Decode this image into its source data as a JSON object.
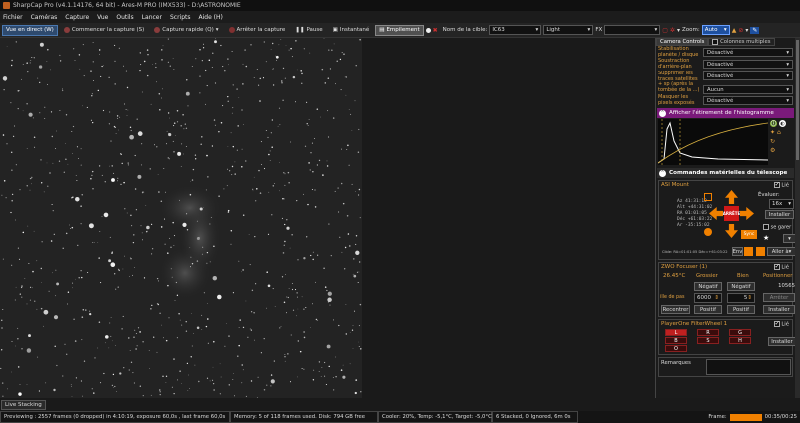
{
  "window": {
    "title": "SharpCap Pro (v4.1.14176, 64 bit) - Ares-M PRO (IMX533) - D:\\ASTRONOMIE"
  },
  "menu": [
    "Fichier",
    "Caméras",
    "Capture",
    "Vue",
    "Outils",
    "Lancer",
    "Scripts",
    "Aide (H)"
  ],
  "toolbar": {
    "live_view": "Vue en direct (W)",
    "start_capture": "Commencer la capture (S)",
    "quick_capture": "Capture rapide (Q)",
    "stop_capture": "Arrêter la capture",
    "pause": "Pause",
    "snapshot": "Instantané",
    "stacking": "Empilement",
    "target_label": "Nom de la cible:",
    "target_value": "IC63",
    "frame_type": "Light",
    "fx_label": "FX",
    "zoom_label": "Zoom:",
    "zoom_value": "Auto"
  },
  "panel": {
    "tabs": [
      "Camera Controls",
      "Colonnes multiples"
    ],
    "controls": [
      {
        "label": "Stabilisation planète / disque",
        "value": "Désactivé"
      },
      {
        "label": "Soustraction d'arrière-plan",
        "value": "Désactivé"
      },
      {
        "label": "Supprimer les traces satellites + sp (après la tombée de la ...)",
        "value": "Désactivé"
      },
      {
        "label": "",
        "value": "Aucun"
      },
      {
        "label": "Masquer les pixels exposés",
        "value": "Désactivé"
      }
    ],
    "histogram_header": "Afficher l'étirement de l'histogramme",
    "telescope_header": "Commandes matérielles du télescope",
    "mount": {
      "title": "ASI Mount",
      "lie": "Lié",
      "evaluer": "Évaluer:",
      "speed": "16x",
      "installer": "Installer",
      "stop": "ARRÊTE",
      "se_garer": "se garer",
      "sync": "Sync",
      "aller_a": "Aller à",
      "coords": [
        {
          "k": "Az",
          "v": "41:31:12"
        },
        {
          "k": "Alt",
          "v": "+44:31:02"
        },
        {
          "k": "RA",
          "v": "01:01:05"
        },
        {
          "k": "Déc",
          "v": "+61:03:22"
        },
        {
          "k": "Ar",
          "v": "-35:15:02"
        }
      ],
      "cible": "Cible: RA=01:01:05 Déc=+61:03:22",
      "env": "Env"
    },
    "focuser": {
      "title": "ZWO Focuser (1)",
      "lie": "Lié",
      "temp": "26.45°C",
      "grossier": "Grossier",
      "bien": "Bien",
      "positionner": "Positionner",
      "negatif": "Négatif",
      "position": "10565",
      "taille_pas": "ille de pas",
      "step_coarse": "6000",
      "step_fine": "5",
      "arreter": "Arrêter",
      "recentrer": "Recentrer",
      "positif": "Positif",
      "installer": "Installer"
    },
    "filterwheel": {
      "title": "PlayerOne FilterWheel 1",
      "lie": "Lié",
      "filters": [
        "L",
        "R",
        "G",
        "B",
        "S",
        "H",
        "O"
      ],
      "selected": "L",
      "installer": "Installer"
    },
    "remarques": "Remarques"
  },
  "live_stacking_tab": "Live Stacking",
  "status": {
    "preview": "Previewing : 2557 frames (0 dropped) in 4:10:19, exposure 60,0s , last frame 60,0s",
    "memory": "Memory: 5 of 118 frames used. Disk: 794 GB free",
    "cooler": "Cooler: 20%, Temp: -5,1°C, Target: -5,0°C",
    "stack": "6 Stacked, 0 Ignored, 6m 0s",
    "frame_label": "Frame:",
    "time": "00:35/00:25"
  },
  "colors": {
    "accent": "#e0a040",
    "purple": "#7a1a7a",
    "orange": "#f08000",
    "red": "#c02020"
  }
}
